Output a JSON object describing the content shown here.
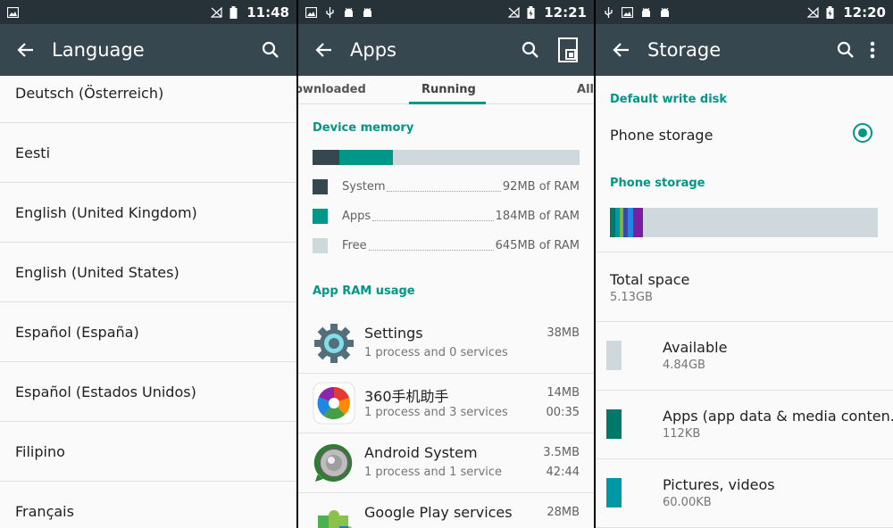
{
  "screen_language": {
    "status": {
      "time": "11:48"
    },
    "appbar": {
      "title": "Language"
    },
    "languages": [
      "Deutsch (Österreich)",
      "Eesti",
      "English (United Kingdom)",
      "English (United States)",
      "Español (España)",
      "Español (Estados Unidos)",
      "Filipino",
      "Français"
    ]
  },
  "screen_apps": {
    "status": {
      "time": "12:21"
    },
    "appbar": {
      "title": "Apps"
    },
    "tabs": {
      "downloaded": "ownloaded",
      "running": "Running",
      "all": "All"
    },
    "device_memory": {
      "heading": "Device memory",
      "bar_fractions": {
        "system": 0.1,
        "apps": 0.2,
        "free": 0.7
      },
      "rows": [
        {
          "label": "System",
          "value": "92MB of RAM",
          "color": "#37474f"
        },
        {
          "label": "Apps",
          "value": "184MB of RAM",
          "color": "#009688"
        },
        {
          "label": "Free",
          "value": "645MB of RAM",
          "color": "#cfd8dc"
        }
      ]
    },
    "app_ram_heading": "App RAM usage",
    "apps": [
      {
        "name": "Settings",
        "sub": "1 process and 0 services",
        "size": "38MB",
        "time": ""
      },
      {
        "name": "360手机助手",
        "sub": "1 process and 3 services",
        "size": "14MB",
        "time": "00:35"
      },
      {
        "name": "Android System",
        "sub": "1 process and 1 service",
        "size": "3.5MB",
        "time": "42:44"
      },
      {
        "name": "Google Play services",
        "sub": "",
        "size": "28MB",
        "time": ""
      }
    ]
  },
  "screen_storage": {
    "status": {
      "time": "12:20"
    },
    "appbar": {
      "title": "Storage"
    },
    "default_write_heading": "Default write disk",
    "phone_storage_option": "Phone storage",
    "phone_storage_heading": "Phone storage",
    "total": {
      "title": "Total space",
      "value": "5.13GB"
    },
    "categories": [
      {
        "title": "Available",
        "value": "4.84GB",
        "color": "#cfd8dc"
      },
      {
        "title": "Apps (app data & media conten..",
        "value": "112KB",
        "color": "#00796b"
      },
      {
        "title": "Pictures, videos",
        "value": "60.00KB",
        "color": "#0097a7"
      }
    ],
    "colors": {
      "accent": "#009688"
    }
  }
}
